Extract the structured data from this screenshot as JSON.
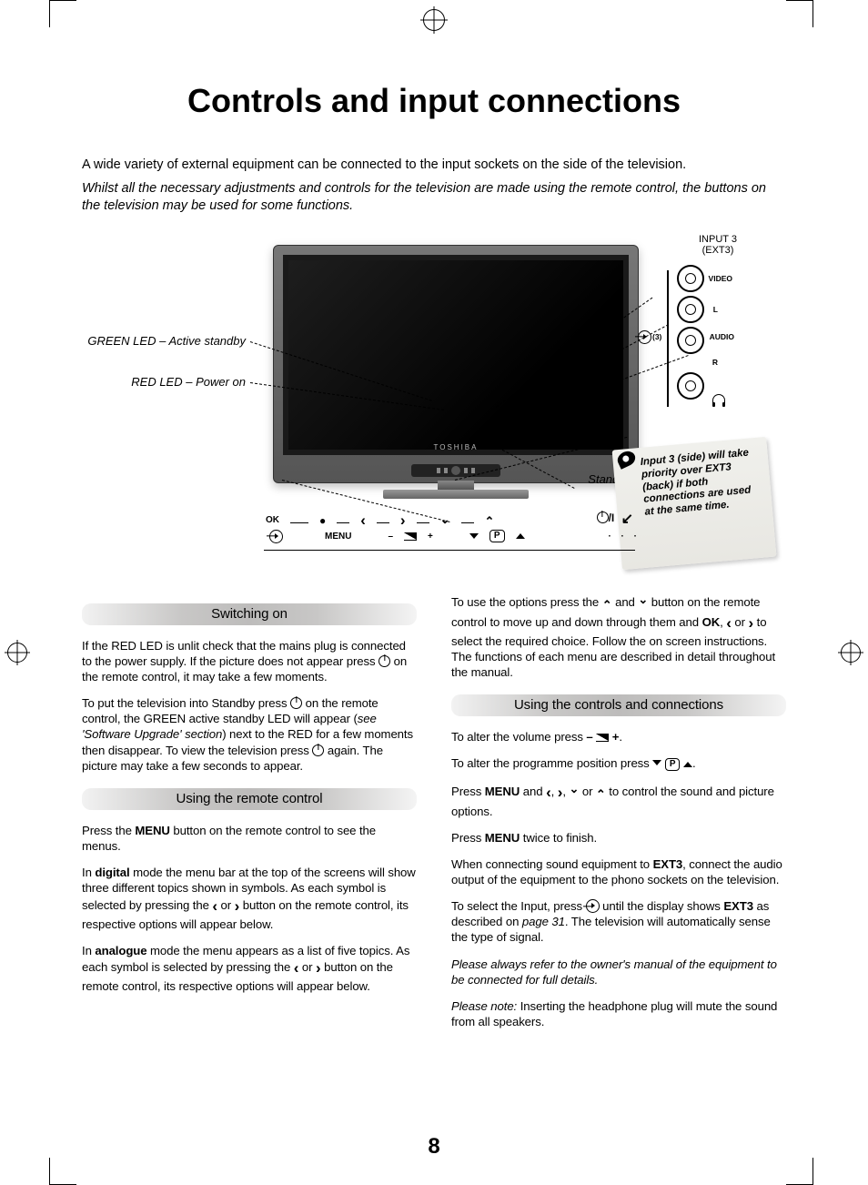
{
  "page_number": "8",
  "title": "Controls and input connections",
  "intro": {
    "p1": "A wide variety of external equipment can be connected to the input sockets on the side of the television.",
    "p2": "Whilst all the necessary adjustments and controls for the television are made using the remote control, the buttons on the television may be used for some functions."
  },
  "diagram": {
    "green_led": "GREEN LED – Active standby",
    "red_led": "RED LED – Power on",
    "brand": "TOSHIBA",
    "input3_label_line1": "INPUT 3",
    "input3_label_line2": "(EXT3)",
    "port_video": "VIDEO",
    "port_audio": "AUDIO",
    "port_l": "L",
    "port_r": "R",
    "side_marker": "(3)",
    "input_icon_marker": "→",
    "standby": "Standby",
    "sticky": "Input 3 (side) will take priority over EXT3 (back) if both connections are used at the same time.",
    "bar": {
      "ok": "OK",
      "menu": "MENU",
      "minus": "–",
      "plus": "+",
      "p": "P",
      "standby_glyph": "⏻/I"
    }
  },
  "sections": {
    "switching_on": {
      "heading": "Switching on",
      "p1a": "If the RED LED is unlit check that the mains plug is connected to the power supply. If the picture does not appear press ",
      "p1b": " on the remote control, it may take a few moments.",
      "p2a": "To put the television into Standby press ",
      "p2b": " on the remote control, the GREEN active standby LED will appear (",
      "p2c": "see 'Software Upgrade' section",
      "p2d": ") next to the RED for a few moments then disappear. To view the television press ",
      "p2e": " again. The picture may take a few seconds to appear."
    },
    "using_remote": {
      "heading": "Using the remote control",
      "p1a": "Press the ",
      "p1_menu": "MENU",
      "p1b": " button on the remote control to see the menus.",
      "p2a": "In ",
      "p2_digital": "digital",
      "p2b": " mode the menu bar at the top of the screens will show three different topics shown in symbols. As each symbol is selected by pressing the ",
      "p2c": " or ",
      "p2d": " button on the remote control, its respective options will appear below.",
      "p3a": "In ",
      "p3_analogue": "analogue",
      "p3b": " mode the menu appears as a list of five topics. As each symbol is selected by pressing the ",
      "p3c": " or ",
      "p3d": " button on the remote control, its respective options will appear below."
    },
    "remote_continued": {
      "p1a": "To use the options press the ",
      "p1b": " and ",
      "p1c": " button on the remote control to move up and down through them and ",
      "p1_ok": "OK",
      "p1d": ", ",
      "p1e": " or ",
      "p1f": " to select the required choice. Follow the on screen instructions. The functions of each menu are described in detail throughout the manual."
    },
    "using_controls": {
      "heading": "Using the controls and connections",
      "p1a": "To alter the volume press ",
      "p1b": ".",
      "p2a": "To alter the programme position press ",
      "p2b": ".",
      "p3a": "Press ",
      "p3_menu": "MENU",
      "p3b": " and ",
      "p3c": ", ",
      "p3d": ", ",
      "p3e": " or ",
      "p3f": " to control the sound and picture options.",
      "p4a": "Press ",
      "p4_menu": "MENU",
      "p4b": " twice to finish.",
      "p5a": "When connecting sound equipment to ",
      "p5_ext3": "EXT3",
      "p5b": ", connect the audio output of the equipment to the phono sockets on the television.",
      "p6a": "To select the Input, press ",
      "p6b": " until the display shows ",
      "p6_ext3": "EXT3",
      "p6c": " as described on ",
      "p6_page": "page 31",
      "p6d": ". The television will automatically sense the type of signal.",
      "p7": "Please always refer to the owner's manual of the equipment to be connected for full details.",
      "p8a": "Please note:",
      "p8b": " Inserting the headphone plug will mute the sound from all speakers."
    }
  }
}
